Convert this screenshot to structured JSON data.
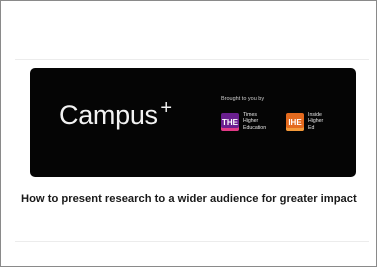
{
  "card": {
    "brand": "Campus",
    "brand_sup": "+",
    "brought_by": "Brought to you by",
    "partners": [
      {
        "icon": "THE",
        "name": "Times\nHigher\nEducation",
        "color": "#6a1f8f"
      },
      {
        "icon": "IHE",
        "name": "Inside\nHigher\nEd",
        "color": "#e46a1e"
      }
    ]
  },
  "article": {
    "title": "How to present research to a wider audience for greater impact"
  }
}
